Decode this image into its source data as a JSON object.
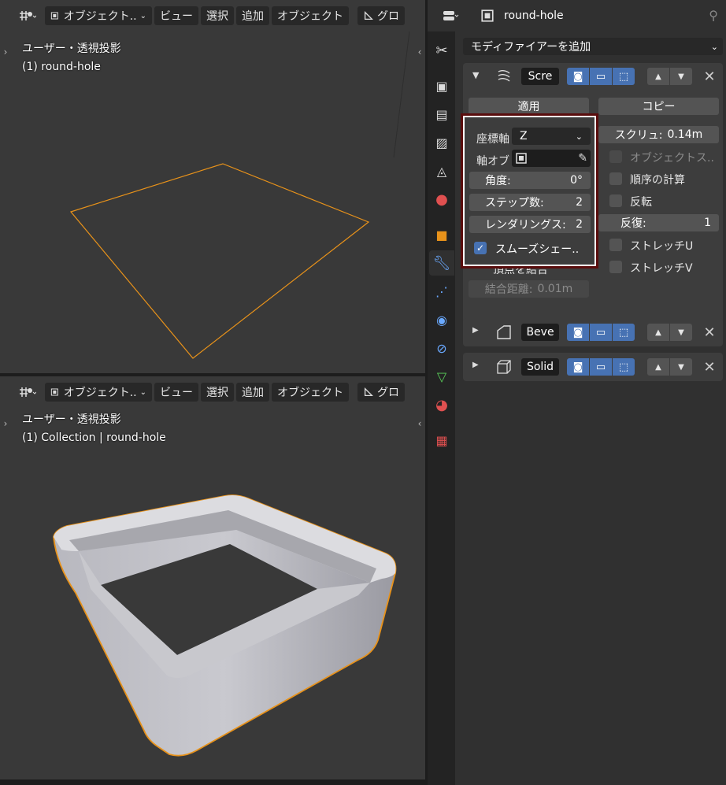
{
  "viewport_top": {
    "header": {
      "editor_icon": "globe-cursor-icon",
      "mode_label": "オブジェクト..",
      "menu": [
        "ビュー",
        "選択",
        "追加",
        "オブジェクト"
      ],
      "transform_label": "グロ"
    },
    "overlay": {
      "view_name": "ユーザー・透視投影",
      "object_info": "(1) round-hole"
    }
  },
  "viewport_bottom": {
    "header": {
      "editor_icon": "globe-cursor-icon",
      "mode_label": "オブジェクト..",
      "menu": [
        "ビュー",
        "選択",
        "追加",
        "オブジェクト"
      ],
      "transform_label": "グロ"
    },
    "overlay": {
      "view_name": "ユーザー・透視投影",
      "object_info": "(1) Collection | round-hole"
    }
  },
  "properties": {
    "object_name": "round-hole",
    "add_modifier": "モディファイアーを追加",
    "screw": {
      "name": "Scre",
      "apply": "適用",
      "copy": "コピー",
      "axis_label": "座標軸",
      "axis_value": "Z",
      "axis_object_label": "軸オブ",
      "angle_label": "角度:",
      "angle_value": "0°",
      "steps_label": "ステップ数:",
      "steps_value": "2",
      "render_steps_label": "レンダリングス:",
      "render_steps_value": "2",
      "smooth_shading": "スムーズシェー..",
      "screw_label": "スクリュ:",
      "screw_value": "0.14m",
      "object_screw": "オブジェクトス..",
      "calc_order": "順序の計算",
      "flip": "反転",
      "iterations_label": "反復:",
      "iterations_value": "1",
      "stretch_u": "ストレッチU",
      "stretch_v": "ストレッチV",
      "merge_vertices": "頂点を結合",
      "merge_dist_label": "結合距離:",
      "merge_dist_value": "0.01m"
    },
    "bevel": {
      "name": "Beve"
    },
    "solidify": {
      "name": "Solid"
    }
  },
  "colors": {
    "accent": "#4772b3",
    "selection": "#e8921a",
    "highlight_border": "#5a0d0d"
  }
}
